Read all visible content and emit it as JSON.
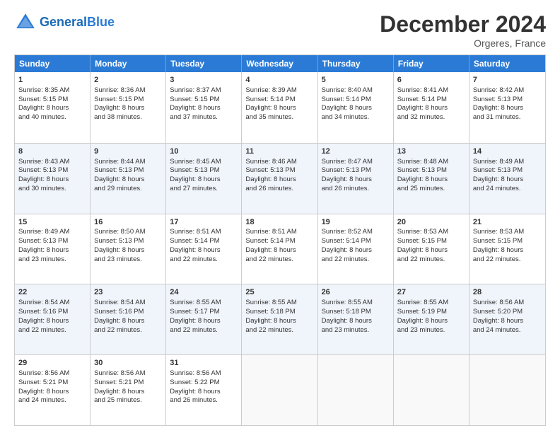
{
  "header": {
    "logo_general": "General",
    "logo_blue": "Blue",
    "month_title": "December 2024",
    "subtitle": "Orgeres, France"
  },
  "weekdays": [
    "Sunday",
    "Monday",
    "Tuesday",
    "Wednesday",
    "Thursday",
    "Friday",
    "Saturday"
  ],
  "rows": [
    [
      {
        "day": "1",
        "lines": [
          "Sunrise: 8:35 AM",
          "Sunset: 5:15 PM",
          "Daylight: 8 hours",
          "and 40 minutes."
        ]
      },
      {
        "day": "2",
        "lines": [
          "Sunrise: 8:36 AM",
          "Sunset: 5:15 PM",
          "Daylight: 8 hours",
          "and 38 minutes."
        ]
      },
      {
        "day": "3",
        "lines": [
          "Sunrise: 8:37 AM",
          "Sunset: 5:15 PM",
          "Daylight: 8 hours",
          "and 37 minutes."
        ]
      },
      {
        "day": "4",
        "lines": [
          "Sunrise: 8:39 AM",
          "Sunset: 5:14 PM",
          "Daylight: 8 hours",
          "and 35 minutes."
        ]
      },
      {
        "day": "5",
        "lines": [
          "Sunrise: 8:40 AM",
          "Sunset: 5:14 PM",
          "Daylight: 8 hours",
          "and 34 minutes."
        ]
      },
      {
        "day": "6",
        "lines": [
          "Sunrise: 8:41 AM",
          "Sunset: 5:14 PM",
          "Daylight: 8 hours",
          "and 32 minutes."
        ]
      },
      {
        "day": "7",
        "lines": [
          "Sunrise: 8:42 AM",
          "Sunset: 5:13 PM",
          "Daylight: 8 hours",
          "and 31 minutes."
        ]
      }
    ],
    [
      {
        "day": "8",
        "lines": [
          "Sunrise: 8:43 AM",
          "Sunset: 5:13 PM",
          "Daylight: 8 hours",
          "and 30 minutes."
        ]
      },
      {
        "day": "9",
        "lines": [
          "Sunrise: 8:44 AM",
          "Sunset: 5:13 PM",
          "Daylight: 8 hours",
          "and 29 minutes."
        ]
      },
      {
        "day": "10",
        "lines": [
          "Sunrise: 8:45 AM",
          "Sunset: 5:13 PM",
          "Daylight: 8 hours",
          "and 27 minutes."
        ]
      },
      {
        "day": "11",
        "lines": [
          "Sunrise: 8:46 AM",
          "Sunset: 5:13 PM",
          "Daylight: 8 hours",
          "and 26 minutes."
        ]
      },
      {
        "day": "12",
        "lines": [
          "Sunrise: 8:47 AM",
          "Sunset: 5:13 PM",
          "Daylight: 8 hours",
          "and 26 minutes."
        ]
      },
      {
        "day": "13",
        "lines": [
          "Sunrise: 8:48 AM",
          "Sunset: 5:13 PM",
          "Daylight: 8 hours",
          "and 25 minutes."
        ]
      },
      {
        "day": "14",
        "lines": [
          "Sunrise: 8:49 AM",
          "Sunset: 5:13 PM",
          "Daylight: 8 hours",
          "and 24 minutes."
        ]
      }
    ],
    [
      {
        "day": "15",
        "lines": [
          "Sunrise: 8:49 AM",
          "Sunset: 5:13 PM",
          "Daylight: 8 hours",
          "and 23 minutes."
        ]
      },
      {
        "day": "16",
        "lines": [
          "Sunrise: 8:50 AM",
          "Sunset: 5:13 PM",
          "Daylight: 8 hours",
          "and 23 minutes."
        ]
      },
      {
        "day": "17",
        "lines": [
          "Sunrise: 8:51 AM",
          "Sunset: 5:14 PM",
          "Daylight: 8 hours",
          "and 22 minutes."
        ]
      },
      {
        "day": "18",
        "lines": [
          "Sunrise: 8:51 AM",
          "Sunset: 5:14 PM",
          "Daylight: 8 hours",
          "and 22 minutes."
        ]
      },
      {
        "day": "19",
        "lines": [
          "Sunrise: 8:52 AM",
          "Sunset: 5:14 PM",
          "Daylight: 8 hours",
          "and 22 minutes."
        ]
      },
      {
        "day": "20",
        "lines": [
          "Sunrise: 8:53 AM",
          "Sunset: 5:15 PM",
          "Daylight: 8 hours",
          "and 22 minutes."
        ]
      },
      {
        "day": "21",
        "lines": [
          "Sunrise: 8:53 AM",
          "Sunset: 5:15 PM",
          "Daylight: 8 hours",
          "and 22 minutes."
        ]
      }
    ],
    [
      {
        "day": "22",
        "lines": [
          "Sunrise: 8:54 AM",
          "Sunset: 5:16 PM",
          "Daylight: 8 hours",
          "and 22 minutes."
        ]
      },
      {
        "day": "23",
        "lines": [
          "Sunrise: 8:54 AM",
          "Sunset: 5:16 PM",
          "Daylight: 8 hours",
          "and 22 minutes."
        ]
      },
      {
        "day": "24",
        "lines": [
          "Sunrise: 8:55 AM",
          "Sunset: 5:17 PM",
          "Daylight: 8 hours",
          "and 22 minutes."
        ]
      },
      {
        "day": "25",
        "lines": [
          "Sunrise: 8:55 AM",
          "Sunset: 5:18 PM",
          "Daylight: 8 hours",
          "and 22 minutes."
        ]
      },
      {
        "day": "26",
        "lines": [
          "Sunrise: 8:55 AM",
          "Sunset: 5:18 PM",
          "Daylight: 8 hours",
          "and 23 minutes."
        ]
      },
      {
        "day": "27",
        "lines": [
          "Sunrise: 8:55 AM",
          "Sunset: 5:19 PM",
          "Daylight: 8 hours",
          "and 23 minutes."
        ]
      },
      {
        "day": "28",
        "lines": [
          "Sunrise: 8:56 AM",
          "Sunset: 5:20 PM",
          "Daylight: 8 hours",
          "and 24 minutes."
        ]
      }
    ],
    [
      {
        "day": "29",
        "lines": [
          "Sunrise: 8:56 AM",
          "Sunset: 5:21 PM",
          "Daylight: 8 hours",
          "and 24 minutes."
        ]
      },
      {
        "day": "30",
        "lines": [
          "Sunrise: 8:56 AM",
          "Sunset: 5:21 PM",
          "Daylight: 8 hours",
          "and 25 minutes."
        ]
      },
      {
        "day": "31",
        "lines": [
          "Sunrise: 8:56 AM",
          "Sunset: 5:22 PM",
          "Daylight: 8 hours",
          "and 26 minutes."
        ]
      },
      {
        "day": "",
        "lines": []
      },
      {
        "day": "",
        "lines": []
      },
      {
        "day": "",
        "lines": []
      },
      {
        "day": "",
        "lines": []
      }
    ]
  ]
}
